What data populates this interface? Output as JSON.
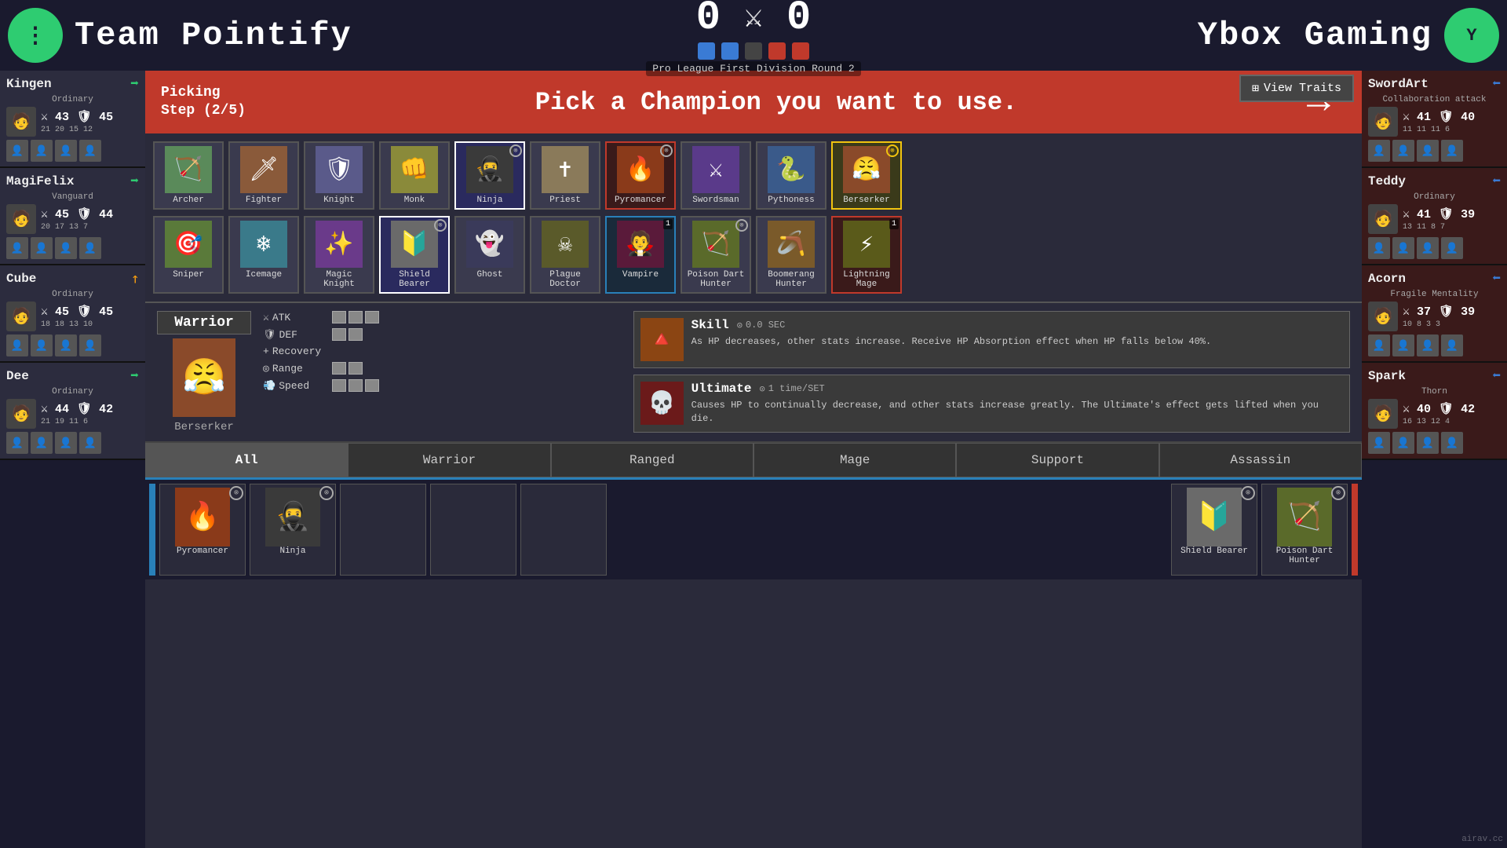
{
  "topbar": {
    "team_left": "Team Pointify",
    "team_right": "Ybox Gaming",
    "score_left": "0",
    "score_right": "0",
    "round_label": "Pro League First Division Round 2",
    "team_left_logo": "⋮",
    "team_right_logo": "Y"
  },
  "picking": {
    "step": "Picking\nStep (2/5)",
    "title": "Pick a Champion you want to use.",
    "view_traits": "View Traits"
  },
  "champions_row1": [
    {
      "name": "Archer",
      "class": "archer",
      "banned": false,
      "picked": false
    },
    {
      "name": "Fighter",
      "class": "fighter",
      "banned": false,
      "picked": false
    },
    {
      "name": "Knight",
      "class": "knight",
      "banned": false,
      "picked": false
    },
    {
      "name": "Monk",
      "class": "monk",
      "banned": false,
      "picked": false
    },
    {
      "name": "Ninja",
      "class": "ninja",
      "banned": false,
      "picked": false,
      "selected": true
    },
    {
      "name": "Priest",
      "class": "priest",
      "banned": false,
      "picked": false
    },
    {
      "name": "Pyromancer",
      "class": "pyromancer",
      "banned": false,
      "picked": true,
      "pick_num": ""
    },
    {
      "name": "Swordsman",
      "class": "swordsman",
      "banned": false,
      "picked": false
    },
    {
      "name": "Pythoness",
      "class": "pythoness",
      "banned": false,
      "picked": false
    },
    {
      "name": "Berserker",
      "class": "berserker",
      "banned": false,
      "picked": false,
      "highlighted": true
    }
  ],
  "champions_row2": [
    {
      "name": "Sniper",
      "class": "sniper",
      "banned": false,
      "picked": false
    },
    {
      "name": "Icemage",
      "class": "icemage",
      "banned": false,
      "picked": false
    },
    {
      "name": "Magic Knight",
      "class": "magicknight",
      "banned": false,
      "picked": false
    },
    {
      "name": "Shield Bearer",
      "class": "shieldbearer",
      "banned": false,
      "picked": false,
      "selected": true
    },
    {
      "name": "Ghost",
      "class": "ghost",
      "banned": false,
      "picked": false
    },
    {
      "name": "Plague Doctor",
      "class": "plaguedoctor",
      "banned": false,
      "picked": false
    },
    {
      "name": "Vampire",
      "class": "vampire",
      "banned": false,
      "picked": true,
      "pick_num": 1,
      "picked_blue": true
    },
    {
      "name": "Poison Dart Hunter",
      "class": "poisondarthunter",
      "banned": false,
      "picked": false,
      "selected2": true
    },
    {
      "name": "Boomerang Hunter",
      "class": "boomeranghunter",
      "banned": false,
      "picked": false
    },
    {
      "name": "Lightning Mage",
      "class": "lightningmage",
      "banned": false,
      "picked": false,
      "pick_num": 1,
      "picked_red": true
    }
  ],
  "selected_champion": {
    "name": "Warrior",
    "class": "Berserker",
    "stats": {
      "atk_bars": 3,
      "def_bars": 2,
      "recovery_bars": 0,
      "range_bars": 2,
      "speed_bars": 3
    },
    "skill": {
      "name": "Skill",
      "cooldown": "0.0 SEC",
      "desc": "As HP decreases, other stats increase. Receive HP Absorption effect when HP falls below 40%."
    },
    "ultimate": {
      "name": "Ultimate",
      "cooldown": "1 time/SET",
      "desc": "Causes HP to continually decrease, and other stats increase greatly. The Ultimate's effect gets lifted when you die."
    }
  },
  "filter_tabs": [
    "All",
    "Warrior",
    "Ranged",
    "Mage",
    "Support",
    "Assassin"
  ],
  "bottom_picks": [
    {
      "name": "Pyromancer",
      "class": "pyromancer",
      "banned": true
    },
    {
      "name": "Ninja",
      "class": "ninja",
      "banned": true
    },
    {
      "name": "",
      "class": "",
      "banned": false
    },
    {
      "name": "",
      "class": "",
      "banned": false
    },
    {
      "name": "",
      "class": "",
      "banned": false
    },
    {
      "name": "Shield Bearer",
      "class": "shieldbearer",
      "banned": true
    },
    {
      "name": "Poison Dart Hunter",
      "class": "poisondarthunter",
      "banned": true
    }
  ],
  "left_players": [
    {
      "name": "Kingen",
      "role": "Ordinary",
      "atk": 43,
      "def": 45,
      "stats2": "21 20 15 12",
      "arrow": "right"
    },
    {
      "name": "MagiFelix",
      "role": "Vanguard",
      "atk": 45,
      "def": 44,
      "stats2": "20 17 13 7",
      "arrow": "right"
    },
    {
      "name": "Cube",
      "role": "Ordinary",
      "atk": 45,
      "def": 45,
      "stats2": "18 18 13 10",
      "arrow": "diag"
    },
    {
      "name": "Dee",
      "role": "Ordinary",
      "atk": 44,
      "def": 42,
      "stats2": "21 19 11 6",
      "arrow": "right"
    }
  ],
  "right_players": [
    {
      "name": "SwordArt",
      "role": "Collaboration attack",
      "atk": 41,
      "def": 40,
      "stats2": "11 11 11 6",
      "arrow": "right"
    },
    {
      "name": "Teddy",
      "role": "Ordinary",
      "atk": 41,
      "def": 39,
      "stats2": "13 11 8 7",
      "arrow": "right"
    },
    {
      "name": "Acorn",
      "role": "Fragile Mentality",
      "atk": 37,
      "def": 39,
      "stats2": "10 8 3 3",
      "arrow": "right"
    },
    {
      "name": "Spark",
      "role": "Thorn",
      "atk": 40,
      "def": 42,
      "stats2": "16 13 12 4",
      "arrow": "right"
    }
  ],
  "watermark": "airav.cc"
}
